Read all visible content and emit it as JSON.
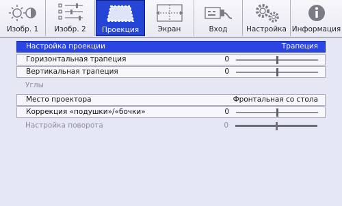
{
  "tabs": [
    {
      "label": "Изобр. 1",
      "icon": "brightness-contrast-icon"
    },
    {
      "label": "Изобр. 2",
      "icon": "sliders-icon"
    },
    {
      "label": "Проекция",
      "icon": "projection-keystone-icon",
      "active": true
    },
    {
      "label": "Экран",
      "icon": "screen-icon"
    },
    {
      "label": "Вход",
      "icon": "input-plug-icon"
    },
    {
      "label": "Настройка",
      "icon": "gears-icon"
    },
    {
      "label": "Информация",
      "icon": "info-icon"
    }
  ],
  "menu": {
    "projection_setting": {
      "label": "Настройка проекции",
      "value": "Трапеция"
    },
    "h_keystone": {
      "label": "Горизонтальная трапеция",
      "value": "0",
      "level": 0.5
    },
    "v_keystone": {
      "label": "Вертикальная трапеция",
      "value": "0",
      "level": 0.5
    },
    "corners": {
      "label": "Углы"
    },
    "projector_position": {
      "label": "Место проектора",
      "value": "Фронтальная со стола"
    },
    "pincushion": {
      "label": "Коррекция «подушки»/«бочки»",
      "value": "0",
      "level": 0.5
    },
    "rotation": {
      "label": "Настройка поворота",
      "value": "0",
      "level": 0.5
    }
  },
  "colors": {
    "accent": "#2b45e2",
    "background": "#e6e7f5",
    "disabled_text": "#8e8e9c"
  }
}
